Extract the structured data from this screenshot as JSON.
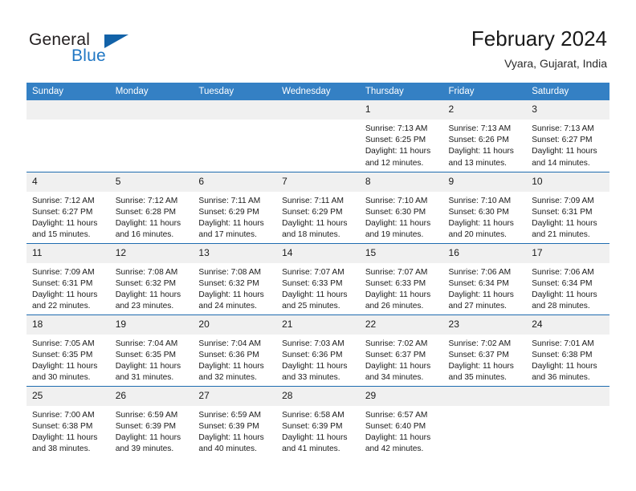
{
  "brand": {
    "name_part1": "General",
    "name_part2": "Blue",
    "mark": "triangle-logo"
  },
  "header": {
    "title": "February 2024",
    "subtitle": "Vyara, Gujarat, India"
  },
  "theme": {
    "header_blue": "#3480c4",
    "rule_blue": "#1f6cb0",
    "daynum_bg": "#f0f0f0",
    "brand_blue": "#2077c4"
  },
  "weekdays": [
    "Sunday",
    "Monday",
    "Tuesday",
    "Wednesday",
    "Thursday",
    "Friday",
    "Saturday"
  ],
  "weeks": [
    [
      {
        "day": "",
        "sunrise": "",
        "sunset": "",
        "daylight1": "",
        "daylight2": ""
      },
      {
        "day": "",
        "sunrise": "",
        "sunset": "",
        "daylight1": "",
        "daylight2": ""
      },
      {
        "day": "",
        "sunrise": "",
        "sunset": "",
        "daylight1": "",
        "daylight2": ""
      },
      {
        "day": "",
        "sunrise": "",
        "sunset": "",
        "daylight1": "",
        "daylight2": ""
      },
      {
        "day": "1",
        "sunrise": "Sunrise: 7:13 AM",
        "sunset": "Sunset: 6:25 PM",
        "daylight1": "Daylight: 11 hours",
        "daylight2": "and 12 minutes."
      },
      {
        "day": "2",
        "sunrise": "Sunrise: 7:13 AM",
        "sunset": "Sunset: 6:26 PM",
        "daylight1": "Daylight: 11 hours",
        "daylight2": "and 13 minutes."
      },
      {
        "day": "3",
        "sunrise": "Sunrise: 7:13 AM",
        "sunset": "Sunset: 6:27 PM",
        "daylight1": "Daylight: 11 hours",
        "daylight2": "and 14 minutes."
      }
    ],
    [
      {
        "day": "4",
        "sunrise": "Sunrise: 7:12 AM",
        "sunset": "Sunset: 6:27 PM",
        "daylight1": "Daylight: 11 hours",
        "daylight2": "and 15 minutes."
      },
      {
        "day": "5",
        "sunrise": "Sunrise: 7:12 AM",
        "sunset": "Sunset: 6:28 PM",
        "daylight1": "Daylight: 11 hours",
        "daylight2": "and 16 minutes."
      },
      {
        "day": "6",
        "sunrise": "Sunrise: 7:11 AM",
        "sunset": "Sunset: 6:29 PM",
        "daylight1": "Daylight: 11 hours",
        "daylight2": "and 17 minutes."
      },
      {
        "day": "7",
        "sunrise": "Sunrise: 7:11 AM",
        "sunset": "Sunset: 6:29 PM",
        "daylight1": "Daylight: 11 hours",
        "daylight2": "and 18 minutes."
      },
      {
        "day": "8",
        "sunrise": "Sunrise: 7:10 AM",
        "sunset": "Sunset: 6:30 PM",
        "daylight1": "Daylight: 11 hours",
        "daylight2": "and 19 minutes."
      },
      {
        "day": "9",
        "sunrise": "Sunrise: 7:10 AM",
        "sunset": "Sunset: 6:30 PM",
        "daylight1": "Daylight: 11 hours",
        "daylight2": "and 20 minutes."
      },
      {
        "day": "10",
        "sunrise": "Sunrise: 7:09 AM",
        "sunset": "Sunset: 6:31 PM",
        "daylight1": "Daylight: 11 hours",
        "daylight2": "and 21 minutes."
      }
    ],
    [
      {
        "day": "11",
        "sunrise": "Sunrise: 7:09 AM",
        "sunset": "Sunset: 6:31 PM",
        "daylight1": "Daylight: 11 hours",
        "daylight2": "and 22 minutes."
      },
      {
        "day": "12",
        "sunrise": "Sunrise: 7:08 AM",
        "sunset": "Sunset: 6:32 PM",
        "daylight1": "Daylight: 11 hours",
        "daylight2": "and 23 minutes."
      },
      {
        "day": "13",
        "sunrise": "Sunrise: 7:08 AM",
        "sunset": "Sunset: 6:32 PM",
        "daylight1": "Daylight: 11 hours",
        "daylight2": "and 24 minutes."
      },
      {
        "day": "14",
        "sunrise": "Sunrise: 7:07 AM",
        "sunset": "Sunset: 6:33 PM",
        "daylight1": "Daylight: 11 hours",
        "daylight2": "and 25 minutes."
      },
      {
        "day": "15",
        "sunrise": "Sunrise: 7:07 AM",
        "sunset": "Sunset: 6:33 PM",
        "daylight1": "Daylight: 11 hours",
        "daylight2": "and 26 minutes."
      },
      {
        "day": "16",
        "sunrise": "Sunrise: 7:06 AM",
        "sunset": "Sunset: 6:34 PM",
        "daylight1": "Daylight: 11 hours",
        "daylight2": "and 27 minutes."
      },
      {
        "day": "17",
        "sunrise": "Sunrise: 7:06 AM",
        "sunset": "Sunset: 6:34 PM",
        "daylight1": "Daylight: 11 hours",
        "daylight2": "and 28 minutes."
      }
    ],
    [
      {
        "day": "18",
        "sunrise": "Sunrise: 7:05 AM",
        "sunset": "Sunset: 6:35 PM",
        "daylight1": "Daylight: 11 hours",
        "daylight2": "and 30 minutes."
      },
      {
        "day": "19",
        "sunrise": "Sunrise: 7:04 AM",
        "sunset": "Sunset: 6:35 PM",
        "daylight1": "Daylight: 11 hours",
        "daylight2": "and 31 minutes."
      },
      {
        "day": "20",
        "sunrise": "Sunrise: 7:04 AM",
        "sunset": "Sunset: 6:36 PM",
        "daylight1": "Daylight: 11 hours",
        "daylight2": "and 32 minutes."
      },
      {
        "day": "21",
        "sunrise": "Sunrise: 7:03 AM",
        "sunset": "Sunset: 6:36 PM",
        "daylight1": "Daylight: 11 hours",
        "daylight2": "and 33 minutes."
      },
      {
        "day": "22",
        "sunrise": "Sunrise: 7:02 AM",
        "sunset": "Sunset: 6:37 PM",
        "daylight1": "Daylight: 11 hours",
        "daylight2": "and 34 minutes."
      },
      {
        "day": "23",
        "sunrise": "Sunrise: 7:02 AM",
        "sunset": "Sunset: 6:37 PM",
        "daylight1": "Daylight: 11 hours",
        "daylight2": "and 35 minutes."
      },
      {
        "day": "24",
        "sunrise": "Sunrise: 7:01 AM",
        "sunset": "Sunset: 6:38 PM",
        "daylight1": "Daylight: 11 hours",
        "daylight2": "and 36 minutes."
      }
    ],
    [
      {
        "day": "25",
        "sunrise": "Sunrise: 7:00 AM",
        "sunset": "Sunset: 6:38 PM",
        "daylight1": "Daylight: 11 hours",
        "daylight2": "and 38 minutes."
      },
      {
        "day": "26",
        "sunrise": "Sunrise: 6:59 AM",
        "sunset": "Sunset: 6:39 PM",
        "daylight1": "Daylight: 11 hours",
        "daylight2": "and 39 minutes."
      },
      {
        "day": "27",
        "sunrise": "Sunrise: 6:59 AM",
        "sunset": "Sunset: 6:39 PM",
        "daylight1": "Daylight: 11 hours",
        "daylight2": "and 40 minutes."
      },
      {
        "day": "28",
        "sunrise": "Sunrise: 6:58 AM",
        "sunset": "Sunset: 6:39 PM",
        "daylight1": "Daylight: 11 hours",
        "daylight2": "and 41 minutes."
      },
      {
        "day": "29",
        "sunrise": "Sunrise: 6:57 AM",
        "sunset": "Sunset: 6:40 PM",
        "daylight1": "Daylight: 11 hours",
        "daylight2": "and 42 minutes."
      },
      {
        "day": "",
        "sunrise": "",
        "sunset": "",
        "daylight1": "",
        "daylight2": ""
      },
      {
        "day": "",
        "sunrise": "",
        "sunset": "",
        "daylight1": "",
        "daylight2": ""
      }
    ]
  ]
}
